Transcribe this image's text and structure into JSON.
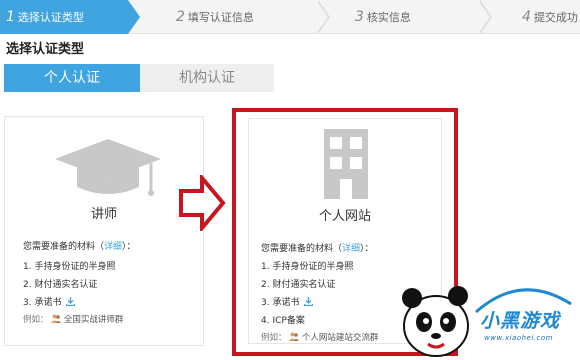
{
  "steps": [
    {
      "num": "1",
      "label": "选择认证类型",
      "active": true
    },
    {
      "num": "2",
      "label": "填写认证信息",
      "active": false
    },
    {
      "num": "3",
      "label": "核实信息",
      "active": false
    },
    {
      "num": "4",
      "label": "提交成功",
      "active": false
    }
  ],
  "section_title": "选择认证类型",
  "type_tabs": {
    "personal": "个人认证",
    "organization": "机构认证"
  },
  "cards": {
    "lecturer": {
      "icon": "graduation-cap-icon",
      "title": "讲师",
      "need_label": "您需要准备的材料",
      "need_open": "（",
      "need_link": "详细",
      "need_close": "）：",
      "items": [
        "1. 手持身份证的半身照",
        "2. 财付通实名认证",
        "3. 承诺书"
      ],
      "example_label": "例如：",
      "example_value": "全国实战讲师群"
    },
    "website": {
      "icon": "building-icon",
      "title": "个人网站",
      "need_label": "您需要准备的材料",
      "need_open": "（",
      "need_link": "详细",
      "need_close": "）：",
      "items": [
        "1. 手持身份证的半身照",
        "2. 财付通实名认证",
        "3. 承诺书",
        "4. ICP备案"
      ],
      "example_label": "例如：",
      "example_value": "个人网站建站交流群"
    }
  },
  "watermark": {
    "brand": "小黑游戏",
    "url": "www.xiaohei.com"
  },
  "colors": {
    "accent": "#3fa4e0",
    "highlight": "#c9151e",
    "tab_inactive": "#efefef"
  }
}
